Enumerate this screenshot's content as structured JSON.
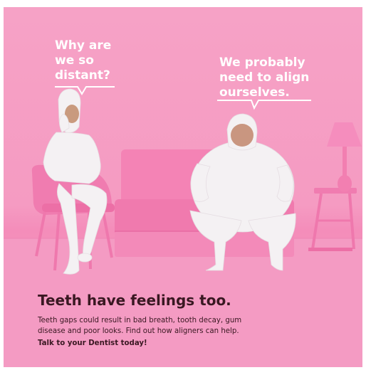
{
  "bubbles": {
    "left": "Why are\nwe so\ndistant?",
    "right": "We probably\nneed to align\nourselves."
  },
  "headline": "Teeth have feelings too.",
  "body": "Teeth gaps could result in bad breath, tooth decay, gum\ndisease and poor looks. Find out how aligners can help.",
  "cta": "Talk to your Dentist today!",
  "colors": {
    "background": "#f59bc2",
    "furniture": "#f27fb1",
    "figure": "#f4f1f3",
    "text_dark": "#3a1822",
    "bubble_text": "#ffffff"
  }
}
